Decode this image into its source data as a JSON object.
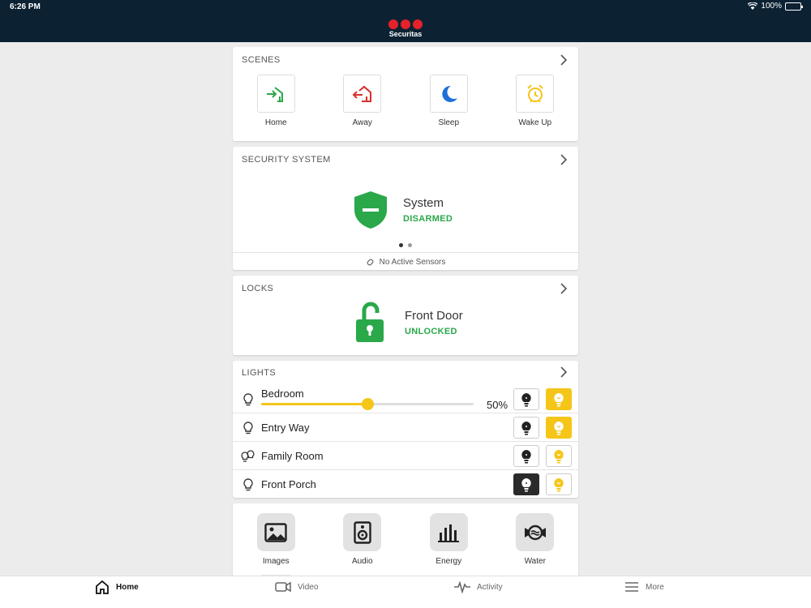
{
  "status_bar": {
    "time": "6:26 PM",
    "battery": "100%"
  },
  "header": {
    "brand": "Securitas"
  },
  "scenes": {
    "title": "SCENES",
    "items": [
      {
        "label": "Home",
        "icon": "home-arrive-icon",
        "color": "#2aa84a"
      },
      {
        "label": "Away",
        "icon": "home-leave-icon",
        "color": "#d9302c"
      },
      {
        "label": "Sleep",
        "icon": "moon-icon",
        "color": "#1f6fd8"
      },
      {
        "label": "Wake Up",
        "icon": "alarm-clock-icon",
        "color": "#f5c518"
      }
    ]
  },
  "security": {
    "title": "SECURITY SYSTEM",
    "name": "System",
    "state": "DISARMED",
    "state_color": "#2aa84a",
    "sensors": "No Active Sensors",
    "page": 1,
    "pages": 2
  },
  "locks": {
    "title": "LOCKS",
    "name": "Front Door",
    "state": "UNLOCKED"
  },
  "lights": {
    "title": "LIGHTS",
    "items": [
      {
        "name": "Bedroom",
        "level": 50,
        "level_label": "50%",
        "state": "on"
      },
      {
        "name": "Entry Way",
        "state": "on"
      },
      {
        "name": "Family Room",
        "state": "off"
      },
      {
        "name": "Front Porch",
        "state": "off"
      }
    ]
  },
  "tiles": [
    {
      "label": "Images",
      "icon": "image-icon"
    },
    {
      "label": "Audio",
      "icon": "speaker-icon"
    },
    {
      "label": "Energy",
      "icon": "bar-chart-icon"
    },
    {
      "label": "Water",
      "icon": "water-icon"
    }
  ],
  "tabs": [
    {
      "label": "Home",
      "icon": "home-icon",
      "active": true
    },
    {
      "label": "Video",
      "icon": "video-camera-icon",
      "active": false
    },
    {
      "label": "Activity",
      "icon": "activity-icon",
      "active": false
    },
    {
      "label": "More",
      "icon": "menu-icon",
      "active": false
    }
  ]
}
